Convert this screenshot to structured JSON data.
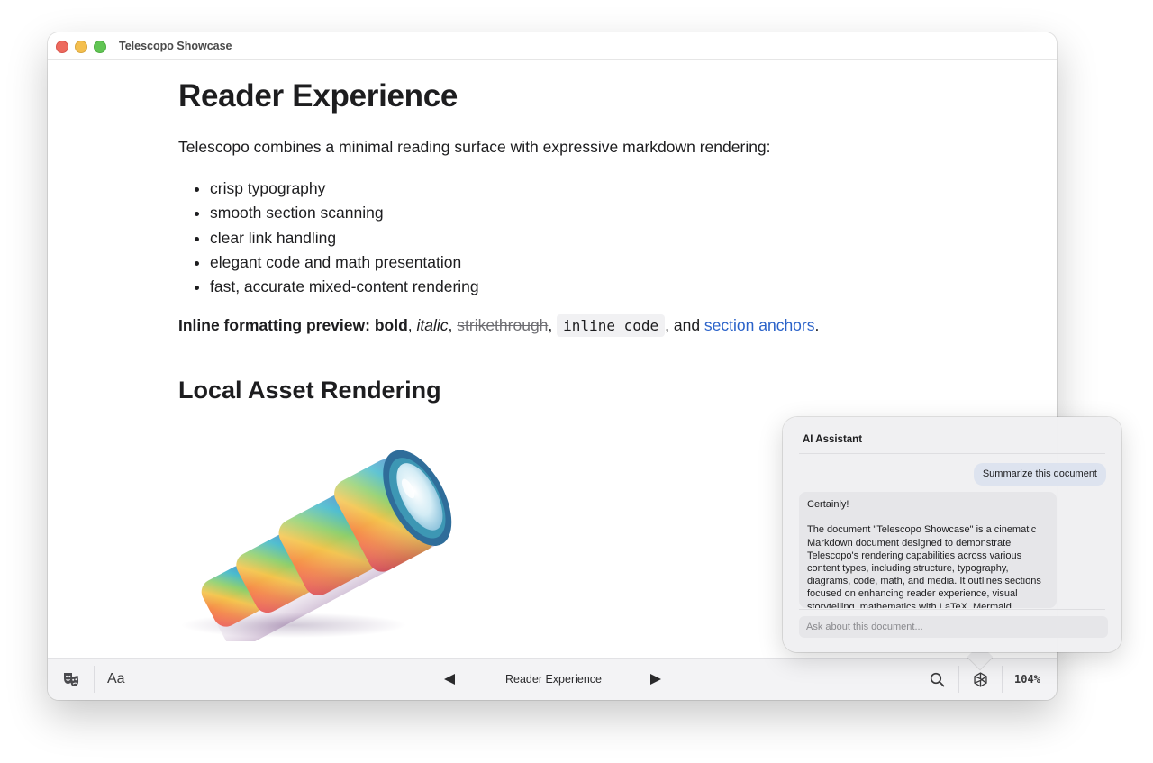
{
  "window": {
    "title": "Telescopo Showcase"
  },
  "document": {
    "heading": "Reader Experience",
    "intro": "Telescopo combines a minimal reading surface with expressive markdown rendering:",
    "bullets": [
      "crisp typography",
      "smooth section scanning",
      "clear link handling",
      "elegant code and math presentation",
      "fast, accurate mixed-content rendering"
    ],
    "inline_preview": {
      "label": "Inline formatting preview:",
      "bold": "bold",
      "sep1": ", ",
      "italic": "italic",
      "sep2": ", ",
      "strike": "strikethrough",
      "sep3": ", ",
      "code": "inline code",
      "sep4": ", and ",
      "link": "section anchors",
      "end": "."
    },
    "subheading": "Local Asset Rendering",
    "image_name": "telescope-illustration"
  },
  "toolbar": {
    "theme_icon": "theater-masks-icon",
    "font_label": "Aa",
    "prev_icon": "triangle-left-icon",
    "section_title": "Reader Experience",
    "next_icon": "triangle-right-icon",
    "search_icon": "search-icon",
    "assistant_icon": "openai-knot-icon",
    "zoom": "104%"
  },
  "assistant": {
    "title": "AI Assistant",
    "user_message": "Summarize this document",
    "reply_first": "Certainly!",
    "reply_body": "The document \"Telescopo Showcase\" is a cinematic Markdown document designed to demonstrate Telescopo's rendering capabilities across various content types, including structure, typography, diagrams, code, math, and media. It outlines sections focused on enhancing reader experience, visual storytelling, mathematics with LaTeX, Mermaid",
    "input_placeholder": "Ask about this document..."
  },
  "colors": {
    "link": "#2a62c9",
    "traffic_close": "#ed6a5e",
    "traffic_min": "#f4bf4f",
    "traffic_max": "#61c554",
    "user_bubble": "#dde3ef"
  }
}
